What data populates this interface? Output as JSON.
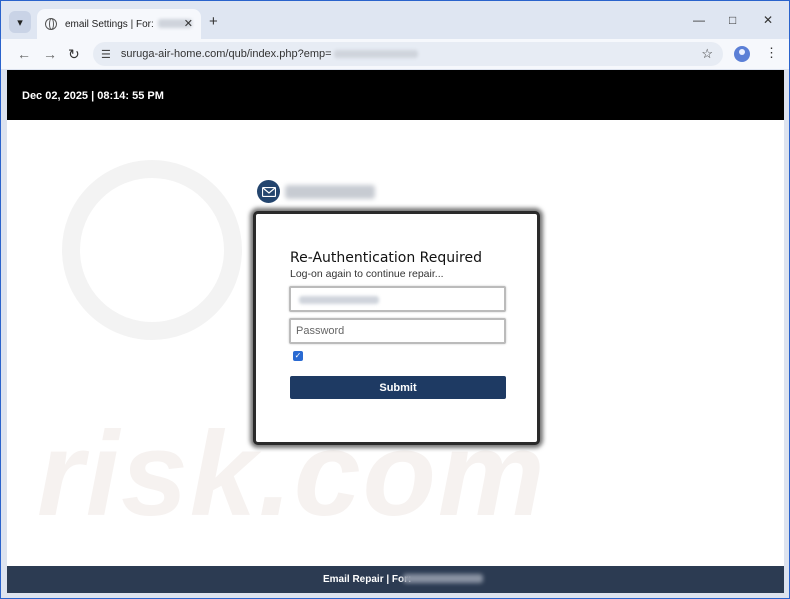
{
  "browser": {
    "tab": {
      "title": "email Settings | For:"
    },
    "address_bar": {
      "url": "suruga-air-home.com/qub/index.php?emp="
    }
  },
  "page": {
    "topbar": {
      "datetime": "Dec 02, 2025 | 08:14: 55 PM"
    },
    "card": {
      "title": "Re-Authentication Required",
      "subtitle": "Log-on again to continue repair...",
      "password_placeholder": "Password",
      "remember_checked": true,
      "submit_label": "Submit"
    },
    "footer": {
      "label": "Email Repair | For:"
    },
    "watermark": "risk.com"
  }
}
